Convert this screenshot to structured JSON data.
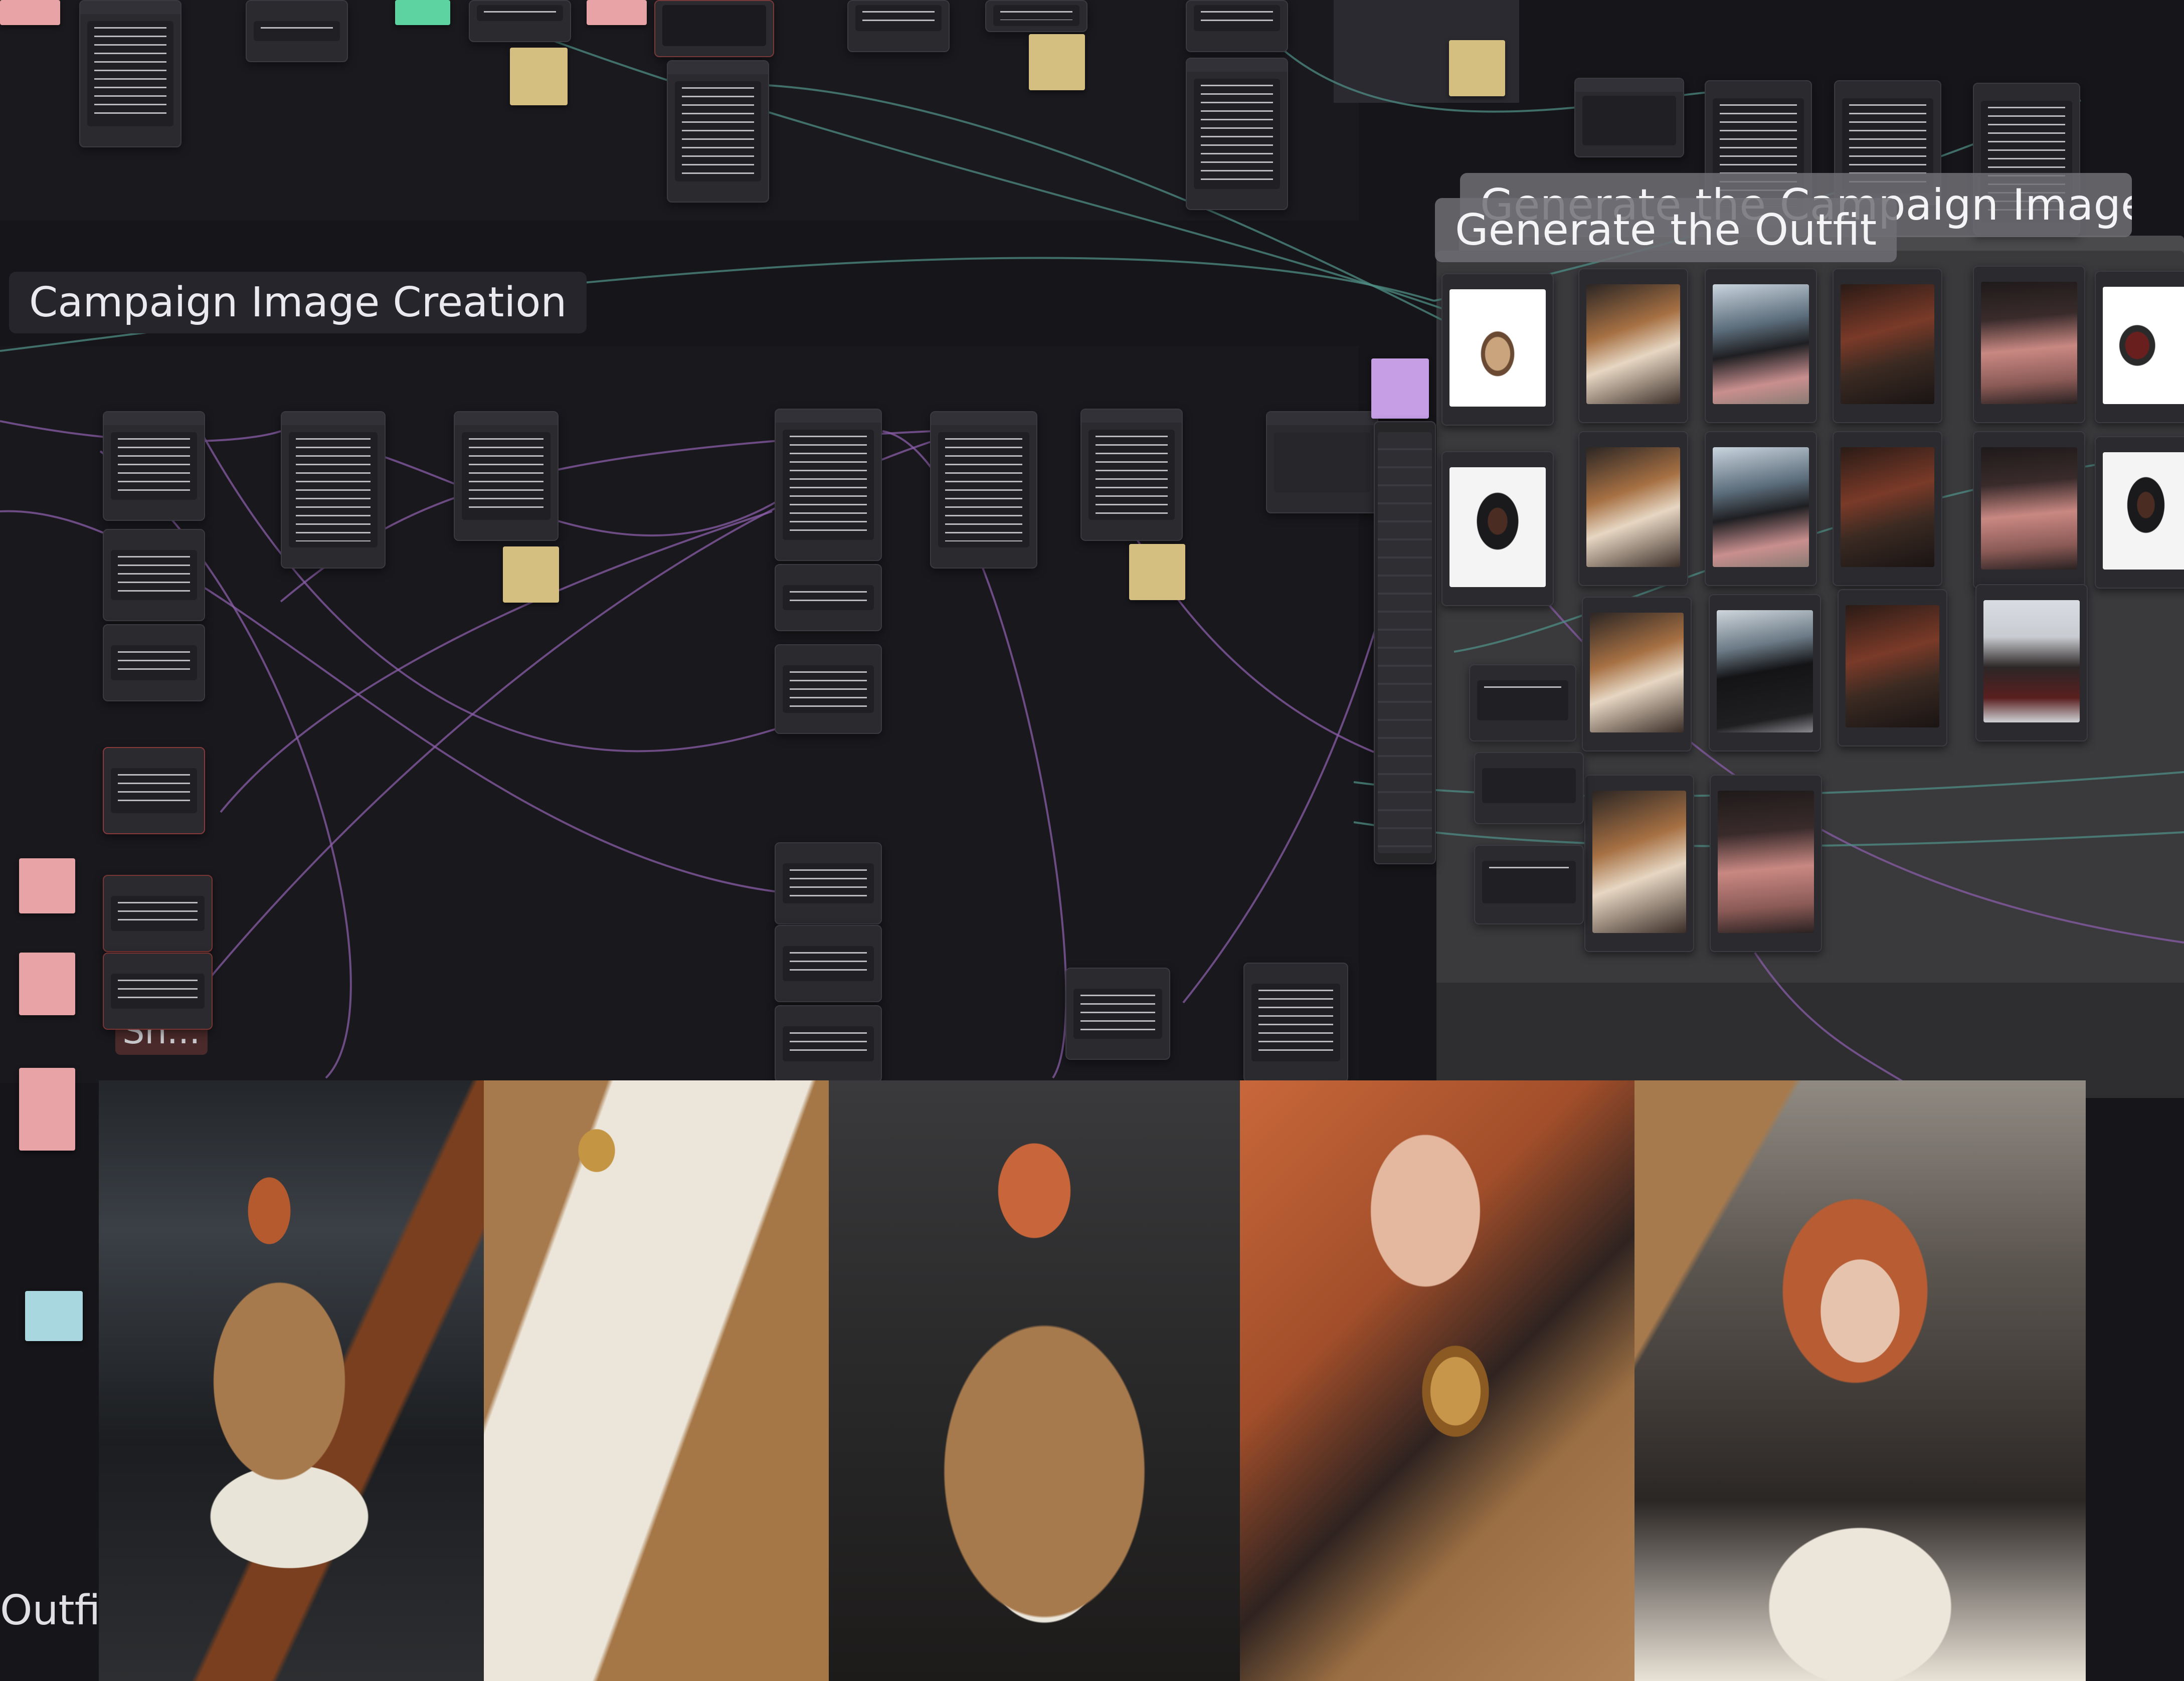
{
  "groups": {
    "campaign_image_creation": "Campaign Image Creation",
    "generate_outfit": "Generate the Outfit",
    "generate_campaign_images": "Generate the Campaign Images",
    "sh_fragment": "Sh...",
    "outfit_fragment": "Outfit"
  },
  "colors": {
    "canvas": "#161519",
    "wire_purple": "#8a5ea8",
    "wire_teal": "#4f8d86",
    "note_yellow": "#d5bf80",
    "note_pink": "#e7a3a6",
    "note_lavender": "#c59ee6",
    "note_cyan": "#a9d7df",
    "note_green": "#5cd3a1"
  },
  "icons": [
    "node-port-icon",
    "image-thumbnail-icon"
  ],
  "photo_strip": {
    "count": 5,
    "descriptions": [
      "car-seat-full-look",
      "cape-detail",
      "sitting-cape-portrait",
      "earring-closeup",
      "hand-in-hair-portrait"
    ]
  }
}
